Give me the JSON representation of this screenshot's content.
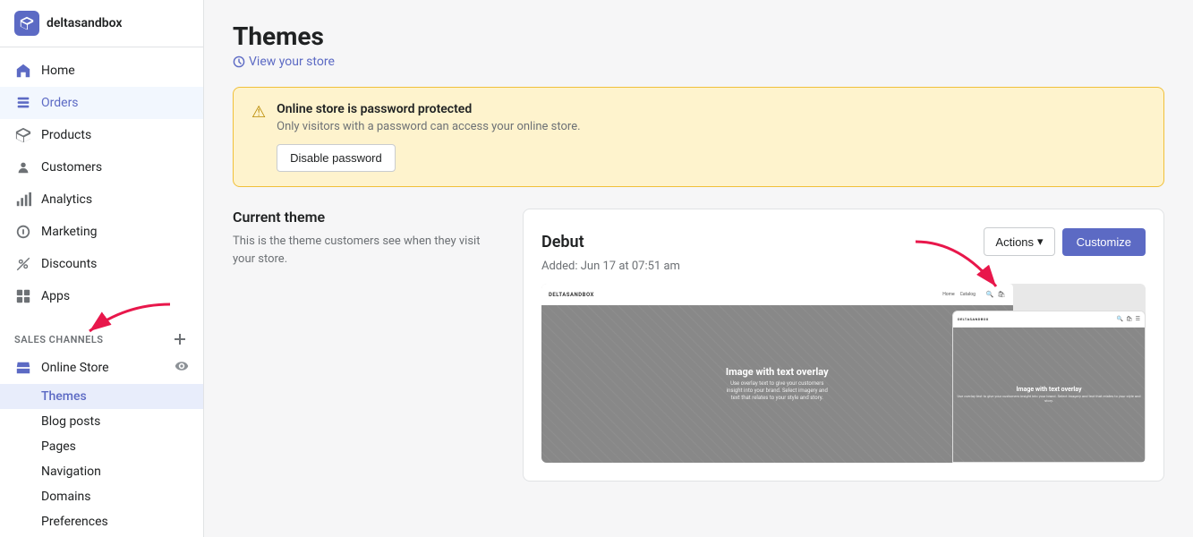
{
  "store": {
    "name": "deltasandbox",
    "logo_color": "#5c6ac4"
  },
  "sidebar": {
    "nav_items": [
      {
        "id": "home",
        "label": "Home",
        "icon": "home"
      },
      {
        "id": "orders",
        "label": "Orders",
        "icon": "orders",
        "active": true
      },
      {
        "id": "products",
        "label": "Products",
        "icon": "products"
      },
      {
        "id": "customers",
        "label": "Customers",
        "icon": "customers"
      },
      {
        "id": "analytics",
        "label": "Analytics",
        "icon": "analytics"
      },
      {
        "id": "marketing",
        "label": "Marketing",
        "icon": "marketing"
      },
      {
        "id": "discounts",
        "label": "Discounts",
        "icon": "discounts"
      },
      {
        "id": "apps",
        "label": "Apps",
        "icon": "apps"
      }
    ],
    "sales_channels_label": "SALES CHANNELS",
    "add_channel_label": "+",
    "online_store_label": "Online Store",
    "sub_items": [
      {
        "id": "themes",
        "label": "Themes",
        "active": true
      },
      {
        "id": "blog-posts",
        "label": "Blog posts"
      },
      {
        "id": "pages",
        "label": "Pages"
      },
      {
        "id": "navigation",
        "label": "Navigation"
      },
      {
        "id": "domains",
        "label": "Domains"
      },
      {
        "id": "preferences",
        "label": "Preferences"
      }
    ]
  },
  "page": {
    "title": "Themes",
    "view_store_label": "View your store"
  },
  "password_banner": {
    "title": "Online store is password protected",
    "subtitle": "Only visitors with a password can access your online store.",
    "button_label": "Disable password"
  },
  "current_theme": {
    "section_label": "Current theme",
    "description": "This is the theme customers see when they visit your store."
  },
  "theme_card": {
    "name": "Debut",
    "added_date": "Added: Jun 17 at 07:51 am",
    "actions_label": "Actions",
    "customize_label": "Customize",
    "preview": {
      "desktop_brand": "DELTASANDBOX",
      "desktop_link1": "Home",
      "desktop_link2": "Catalog",
      "hero_title": "Image with text overlay",
      "hero_subtitle": "Use overlay text to give your customers insight into your brand. Select imagery and text that relates to your style and story.",
      "mobile_brand": "DELTASANDBOX",
      "mobile_hero_title": "Image with text overlay",
      "mobile_hero_subtitle": "Use overlay text to give your customers insight into your brand. Select imagery and text that relates to your style and story."
    }
  }
}
